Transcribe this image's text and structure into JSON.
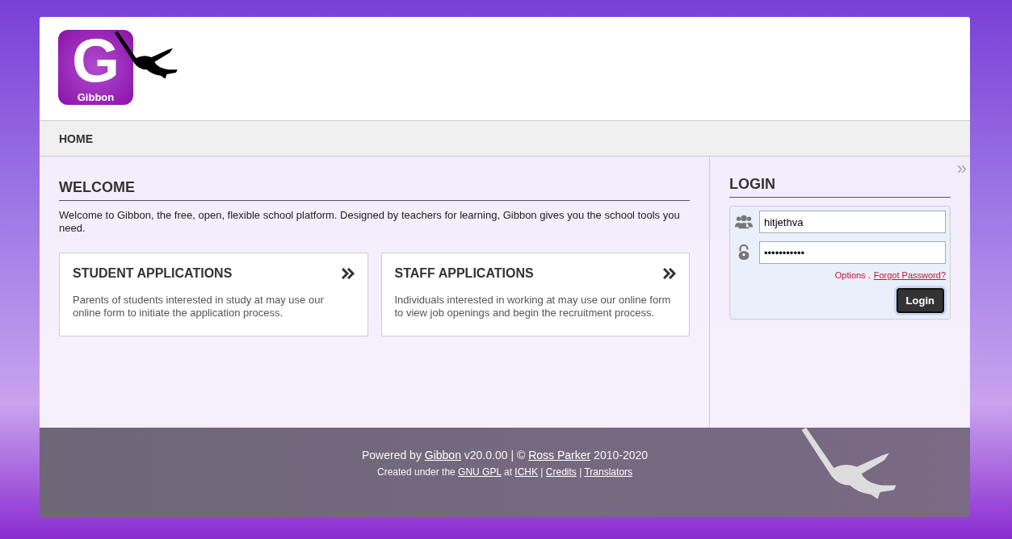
{
  "logo": {
    "letter": "G",
    "name": "Gibbon"
  },
  "nav": [
    {
      "label": "HOME"
    }
  ],
  "welcome": {
    "title": "WELCOME",
    "text": "Welcome to Gibbon, the free, open, flexible school platform. Designed by teachers for learning, Gibbon gives you the school tools you need."
  },
  "cards": [
    {
      "title": "STUDENT APPLICATIONS",
      "text": "Parents of students interested in study at may use our online form to initiate the application process."
    },
    {
      "title": "STAFF APPLICATIONS",
      "text": "Individuals interested in working at may use our online form to view job openings and begin the recruitment process."
    }
  ],
  "sidebar": {
    "collapse": "»",
    "title": "LOGIN",
    "username": "hitjethva",
    "password": "•••••••••••",
    "options": "Options .",
    "forgot": "Forgot Password?",
    "button": "Login"
  },
  "footer": {
    "lines": [
      [
        {
          "kind": "text",
          "text": "Powered by "
        },
        {
          "kind": "link",
          "text": "Gibbon"
        },
        {
          "kind": "text",
          "text": " v20.0.00 | © "
        },
        {
          "kind": "link",
          "text": "Ross Parker"
        },
        {
          "kind": "text",
          "text": " 2010-2020"
        }
      ],
      [
        {
          "kind": "text",
          "text": "Created under the "
        },
        {
          "kind": "link",
          "text": "GNU GPL"
        },
        {
          "kind": "text",
          "text": " at "
        },
        {
          "kind": "link",
          "text": "ICHK"
        },
        {
          "kind": "text",
          "text": " | "
        },
        {
          "kind": "link",
          "text": "Credits"
        },
        {
          "kind": "text",
          "text": " | "
        },
        {
          "kind": "link",
          "text": "Translators"
        }
      ]
    ]
  }
}
